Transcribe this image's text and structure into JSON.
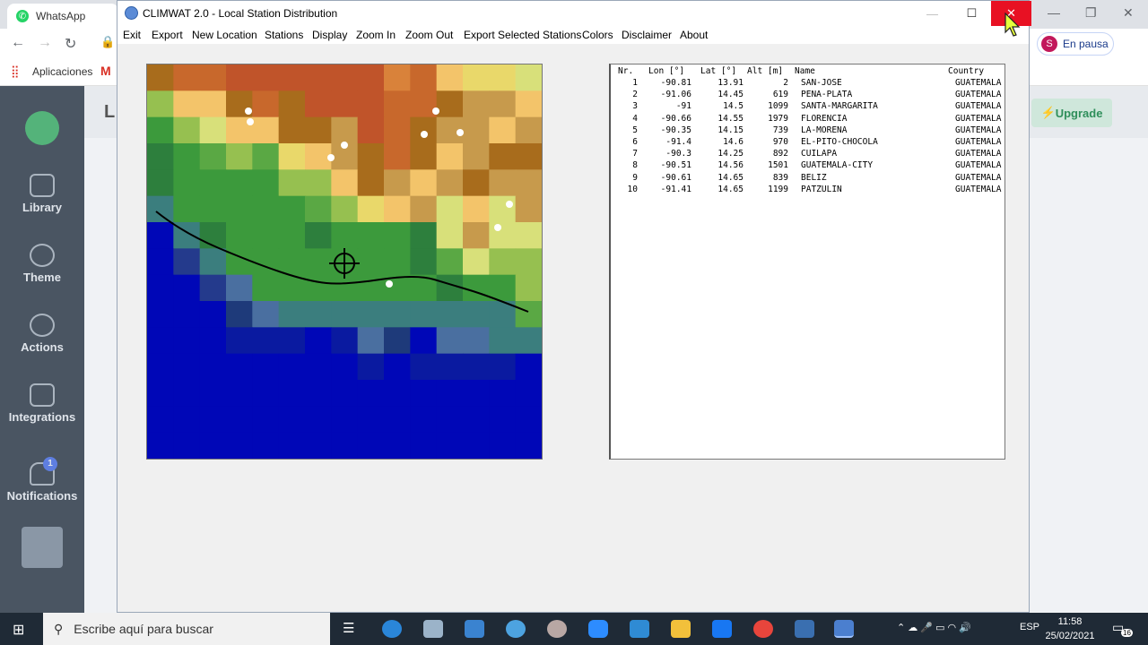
{
  "browser": {
    "tab_title": "WhatsApp",
    "bookmarks_label": "Aplicaciones",
    "profile_status": "En pausa",
    "profile_initial": "S"
  },
  "app_behind": {
    "sidebar": [
      {
        "label": "Library",
        "icon": "library-icon"
      },
      {
        "label": "Theme",
        "icon": "palette-icon"
      },
      {
        "label": "Actions",
        "icon": "actions-icon"
      },
      {
        "label": "Integrations",
        "icon": "puzzle-icon"
      },
      {
        "label": "Notifications",
        "icon": "bell-icon",
        "badge": "1"
      }
    ],
    "header_letter": "L",
    "upgrade_label": "Upgrade"
  },
  "window": {
    "title": "CLIMWAT 2.0 - Local Station Distribution",
    "menu": [
      "Exit",
      "Export",
      "New Location",
      "Stations",
      "Display",
      "Zoom In",
      "Zoom Out",
      "Export Selected Stations",
      "Colors",
      "Disclaimer",
      "About"
    ]
  },
  "table": {
    "headers": [
      "Nr.",
      "Lon [°]",
      "Lat [°]",
      "Alt [m]",
      "Name",
      "Country"
    ],
    "rows": [
      [
        "1",
        "-90.81",
        "13.91",
        "2",
        "SAN-JOSE",
        "GUATEMALA"
      ],
      [
        "2",
        "-91.06",
        "14.45",
        "619",
        "PENA-PLATA",
        "GUATEMALA"
      ],
      [
        "3",
        "-91",
        "14.5",
        "1099",
        "SANTA-MARGARITA",
        "GUATEMALA"
      ],
      [
        "4",
        "-90.66",
        "14.55",
        "1979",
        "FLORENCIA",
        "GUATEMALA"
      ],
      [
        "5",
        "-90.35",
        "14.15",
        "739",
        "LA-MORENA",
        "GUATEMALA"
      ],
      [
        "6",
        "-91.4",
        "14.6",
        "970",
        "EL-PITO-CHOCOLA",
        "GUATEMALA"
      ],
      [
        "7",
        "-90.3",
        "14.25",
        "892",
        "CUILAPA",
        "GUATEMALA"
      ],
      [
        "8",
        "-90.51",
        "14.56",
        "1501",
        "GUATEMALA-CITY",
        "GUATEMALA"
      ],
      [
        "9",
        "-90.61",
        "14.65",
        "839",
        "BELIZ",
        "GUATEMALA"
      ],
      [
        "10",
        "-91.41",
        "14.65",
        "1199",
        "PATZULIN",
        "GUATEMALA"
      ]
    ]
  },
  "taskbar": {
    "search_placeholder": "Escribe aquí para buscar",
    "language": "ESP",
    "time": "11:58",
    "date": "25/02/2021",
    "notification_count": "16"
  },
  "colors": {
    "close_button": "#e81123",
    "sea": "#0007b7",
    "taskbar": "#1f2a36"
  }
}
